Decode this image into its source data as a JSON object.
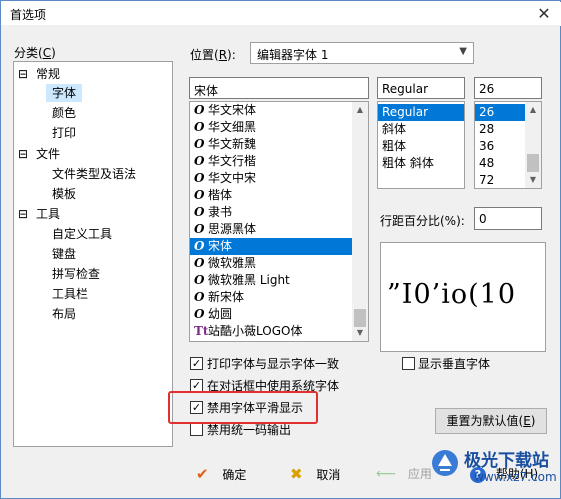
{
  "window": {
    "title": "首选项",
    "close_glyph": "✕"
  },
  "category": {
    "label": "分类(",
    "hotkey": "C",
    "label_end": ")",
    "tree": [
      {
        "text": "常规",
        "expander": "⊟"
      },
      {
        "text": "字体"
      },
      {
        "text": "颜色"
      },
      {
        "text": "打印"
      },
      {
        "text": "文件",
        "expander": "⊟"
      },
      {
        "text": "文件类型及语法"
      },
      {
        "text": "模板"
      },
      {
        "text": "工具",
        "expander": "⊟"
      },
      {
        "text": "自定义工具"
      },
      {
        "text": "键盘"
      },
      {
        "text": "拼写检查"
      },
      {
        "text": "工具栏"
      },
      {
        "text": "布局"
      }
    ]
  },
  "position": {
    "label": "位置(",
    "hotkey": "R",
    "label_end": "):",
    "value": "编辑器字体 1"
  },
  "font_name": {
    "value": "宋体",
    "items": [
      {
        "icon": "O",
        "name": "华文宋体"
      },
      {
        "icon": "O",
        "name": "华文细黑"
      },
      {
        "icon": "O",
        "name": "华文新魏"
      },
      {
        "icon": "O",
        "name": "华文行楷"
      },
      {
        "icon": "O",
        "name": "华文中宋"
      },
      {
        "icon": "O",
        "name": "楷体"
      },
      {
        "icon": "O",
        "name": "隶书"
      },
      {
        "icon": "O",
        "name": "思源黑体"
      },
      {
        "icon": "O",
        "name": "宋体"
      },
      {
        "icon": "O",
        "name": "微软雅黑"
      },
      {
        "icon": "O",
        "name": "微软雅黑 Light"
      },
      {
        "icon": "O",
        "name": "新宋体"
      },
      {
        "icon": "O",
        "name": "幼圆"
      },
      {
        "icon": "Tt",
        "name": "站酷小薇LOGO体"
      }
    ],
    "selected": "宋体"
  },
  "font_style": {
    "value": "Regular",
    "items": [
      "Regular",
      "斜体",
      "粗体",
      "粗体 斜体"
    ],
    "selected": "Regular"
  },
  "font_size": {
    "value": "26",
    "items": [
      "26",
      "28",
      "36",
      "48",
      "72"
    ],
    "selected": "26"
  },
  "line_spacing": {
    "label": "行距百分比(%):",
    "value": "0"
  },
  "preview_text": "”I0’io(10",
  "checkboxes": {
    "print_font_same": {
      "label": "打印字体与显示字体一致",
      "checked": true
    },
    "show_vertical_font": {
      "label": "显示垂直字体",
      "checked": false
    },
    "use_system_font_in_dialogs": {
      "label": "在对话框中使用系统字体",
      "checked": true
    },
    "disable_font_smoothing": {
      "label": "禁用字体平滑显示",
      "checked": true
    },
    "disable_unified_output": {
      "label": "禁用统一码输出",
      "checked": false
    }
  },
  "reset_button": {
    "label": "重置为默认值(",
    "hotkey": "E",
    "label_end": ")"
  },
  "footer": {
    "ok": {
      "icon": "✔",
      "label": "确定"
    },
    "cancel": {
      "icon": "✖",
      "label": "取消"
    },
    "apply": {
      "icon": "⟵",
      "label": "应用"
    },
    "help": {
      "icon": "?",
      "label": "帮助(H)"
    }
  },
  "watermark": {
    "title": "极光下载站",
    "url": "www.xz7.com"
  },
  "colors": {
    "accent": "#0078d7",
    "highlight_box": "#e03030",
    "tree_selection": "#cce8ff"
  }
}
